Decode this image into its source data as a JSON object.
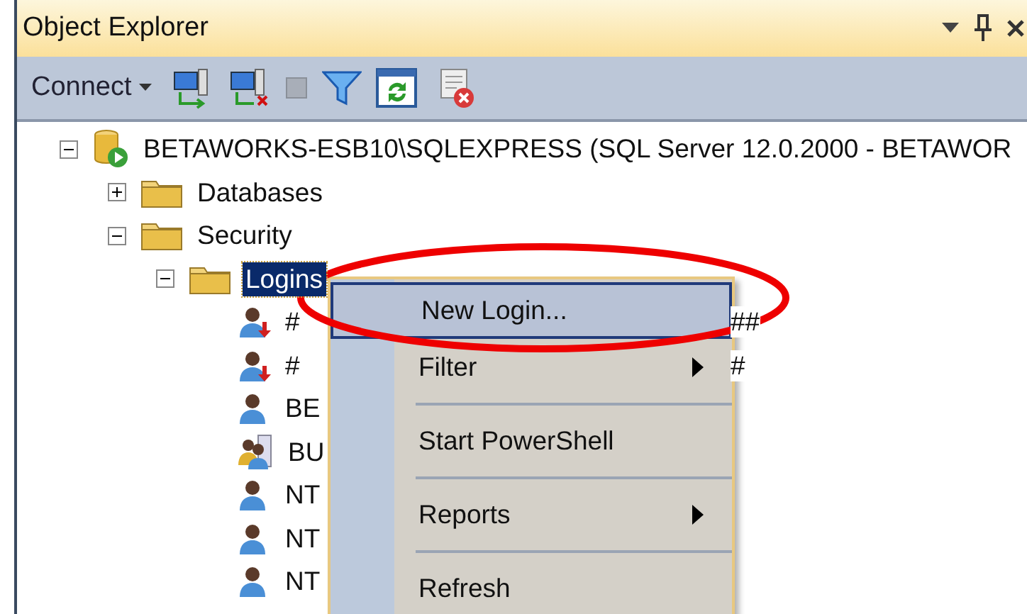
{
  "panel": {
    "title": "Object Explorer"
  },
  "toolbar": {
    "connect": "Connect"
  },
  "tree": [
    {
      "label": "BETAWORKS-ESB10\\SQLEXPRESS (SQL Server 12.0.2000 - BETAWOR",
      "kind": "server",
      "expanded": true,
      "selected": false,
      "children": [
        {
          "label": "Databases",
          "kind": "folder",
          "expanded": false,
          "selected": false
        },
        {
          "label": "Security",
          "kind": "folder",
          "expanded": true,
          "selected": false,
          "children": [
            {
              "label": "Logins",
              "kind": "folder",
              "expanded": true,
              "selected": true,
              "children": [
                {
                  "label": "#",
                  "tail": "##",
                  "kind": "login-disabled",
                  "selected": false
                },
                {
                  "label": "#",
                  "tail": "#",
                  "kind": "login-disabled",
                  "selected": false
                },
                {
                  "label": "BE",
                  "kind": "login",
                  "selected": false
                },
                {
                  "label": "BU",
                  "kind": "group",
                  "selected": false
                },
                {
                  "label": "NT",
                  "kind": "login",
                  "selected": false
                },
                {
                  "label": "NT",
                  "kind": "login",
                  "selected": false
                },
                {
                  "label": "NT",
                  "kind": "login",
                  "selected": false
                }
              ]
            }
          ]
        }
      ]
    }
  ],
  "context_menu": [
    {
      "kind": "command",
      "label": "New Login...",
      "selected": true,
      "submenu": false
    },
    {
      "kind": "command",
      "label": "Filter",
      "selected": false,
      "submenu": true
    },
    {
      "kind": "separator"
    },
    {
      "kind": "command",
      "label": "Start PowerShell",
      "selected": false,
      "submenu": false
    },
    {
      "kind": "separator"
    },
    {
      "kind": "command",
      "label": "Reports",
      "selected": false,
      "submenu": true
    },
    {
      "kind": "separator"
    },
    {
      "kind": "command",
      "label": "Refresh",
      "selected": false,
      "submenu": false
    }
  ]
}
